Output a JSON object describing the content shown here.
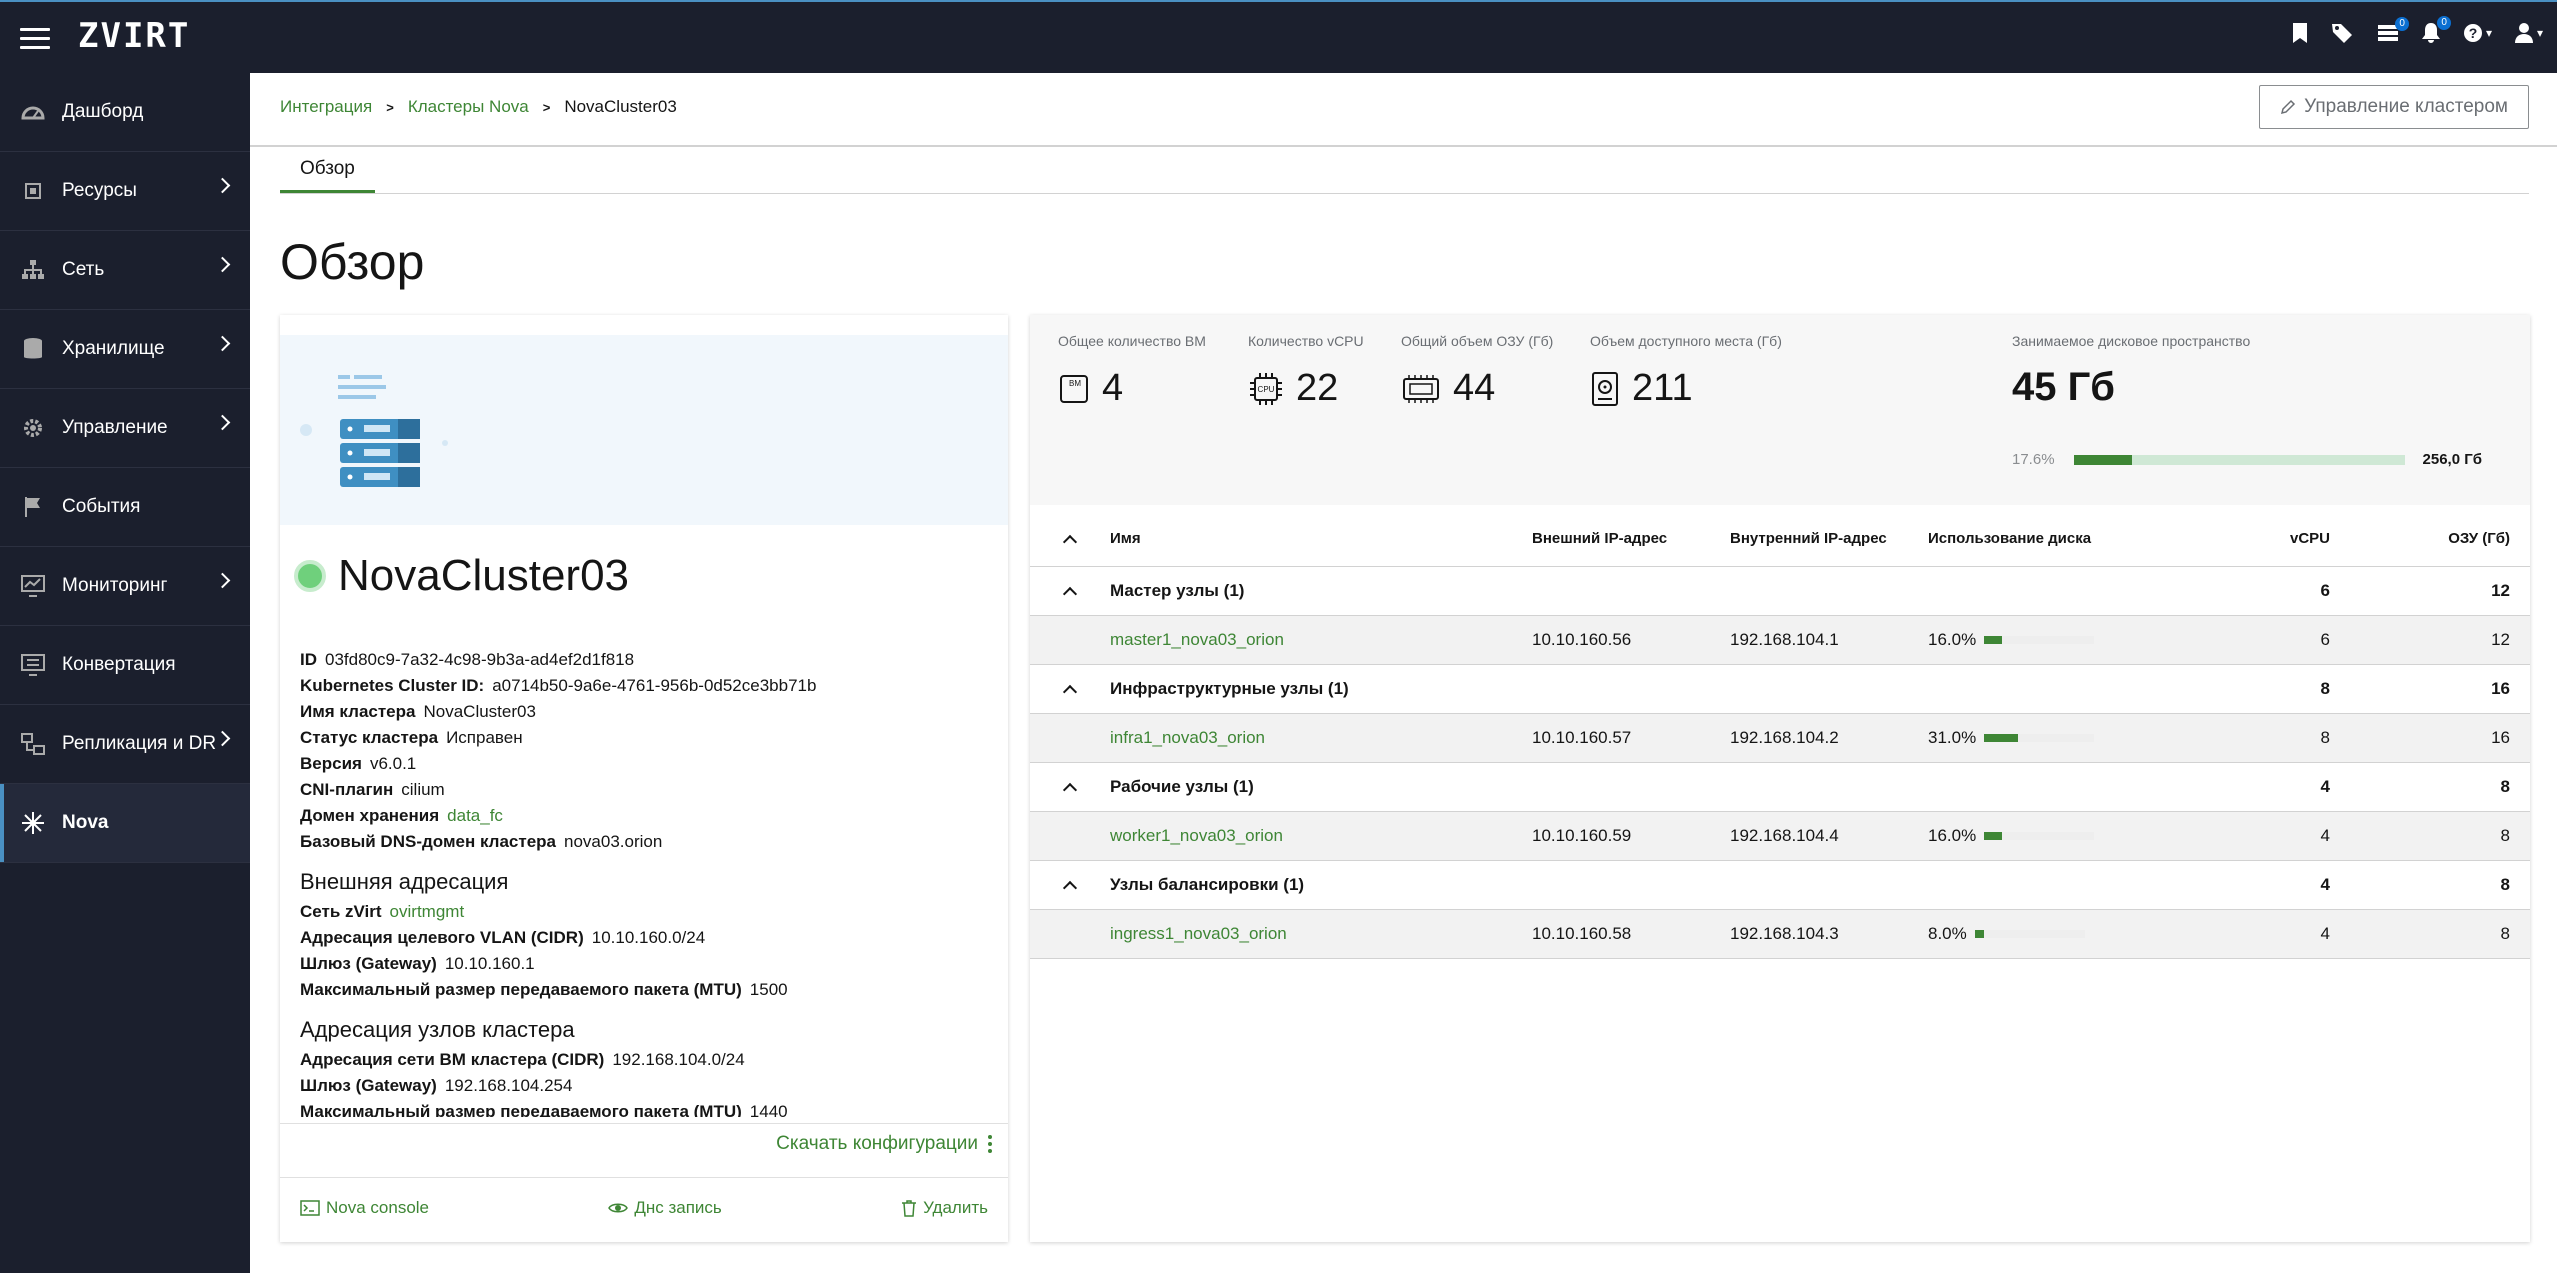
{
  "header": {
    "logo": "ZVIRT",
    "badge_tasks": "0",
    "badge_notifications": "0"
  },
  "sidebar": {
    "items": [
      {
        "label": "Дашборд"
      },
      {
        "label": "Ресурсы"
      },
      {
        "label": "Сеть"
      },
      {
        "label": "Хранилище"
      },
      {
        "label": "Управление"
      },
      {
        "label": "События"
      },
      {
        "label": "Мониторинг"
      },
      {
        "label": "Конвертация"
      },
      {
        "label": "Репликация и DR"
      },
      {
        "label": "Nova"
      }
    ]
  },
  "breadcrumb": {
    "items": [
      "Интеграция",
      "Кластеры Nova",
      "NovaCluster03"
    ]
  },
  "manage_button": "Управление кластером",
  "tabs": [
    "Обзор"
  ],
  "page_title": "Обзор",
  "cluster": {
    "name": "NovaCluster03",
    "status_color": "#6fd07c",
    "info": [
      {
        "key": "ID",
        "value": "03fd80c9-7a32-4c98-9b3a-ad4ef2d1f818"
      },
      {
        "key": "Kubernetes Cluster ID:",
        "value": "a0714b50-9a6e-4761-956b-0d52ce3bb71b"
      },
      {
        "key": "Имя кластера",
        "value": "NovaCluster03"
      },
      {
        "key": "Статус кластера",
        "value": "Исправен"
      },
      {
        "key": "Версия",
        "value": "v6.0.1"
      },
      {
        "key": "CNI-плагин",
        "value": "cilium"
      },
      {
        "key": "Домен хранения",
        "value": "data_fc"
      },
      {
        "key": "Базовый DNS-домен кластера",
        "value": "nova03.orion"
      }
    ],
    "external": {
      "title": "Внешняя адресация",
      "items": [
        {
          "key": "Сеть zVirt",
          "value": "ovirtmgmt"
        },
        {
          "key": "Адресация целевого VLAN (CIDR)",
          "value": "10.10.160.0/24"
        },
        {
          "key": "Шлюз (Gateway)",
          "value": "10.10.160.1"
        },
        {
          "key": "Максимальный размер передаваемого пакета (MTU)",
          "value": "1500"
        }
      ]
    },
    "nodes_addr": {
      "title": "Адресация узлов кластера",
      "items": [
        {
          "key": "Адресация сети ВМ кластера (CIDR)",
          "value": "192.168.104.0/24"
        },
        {
          "key": "Шлюз (Gateway)",
          "value": "192.168.104.254"
        },
        {
          "key": "Максимальный размер передаваемого пакета (MTU)",
          "value": "1440"
        }
      ]
    },
    "download_config": "Скачать конфигурации",
    "actions": {
      "console": "Nova console",
      "dns": "Днс запись",
      "delete": "Удалить"
    }
  },
  "stats": {
    "vm": {
      "label": "Общее количество ВМ",
      "value": "4"
    },
    "vcpu": {
      "label": "Количество vCPU",
      "value": "22"
    },
    "ram": {
      "label": "Общий объем ОЗУ (Гб)",
      "value": "44"
    },
    "space": {
      "label": "Объем доступного места (Гб)",
      "value": "211"
    },
    "disk": {
      "label": "Занимаемое дисковое пространство",
      "value": "45 Гб",
      "percent": "17.6%",
      "fraction": 0.176,
      "total": "256,0 Гб"
    }
  },
  "table": {
    "headers": {
      "name": "Имя",
      "ext_ip": "Внешний IP-адрес",
      "int_ip": "Внутренний IP-адрес",
      "disk": "Использование диска",
      "vcpu": "vCPU",
      "ram": "ОЗУ (Гб)"
    },
    "groups": [
      {
        "name": "Мастер узлы (1)",
        "vcpu": "6",
        "ram": "12",
        "node": {
          "name": "master1_nova03_orion",
          "ext_ip": "10.10.160.56",
          "int_ip": "192.168.104.1",
          "disk": "16.0%",
          "disk_fraction": 0.16,
          "vcpu": "6",
          "ram": "12"
        }
      },
      {
        "name": "Инфраструктурные узлы (1)",
        "vcpu": "8",
        "ram": "16",
        "node": {
          "name": "infra1_nova03_orion",
          "ext_ip": "10.10.160.57",
          "int_ip": "192.168.104.2",
          "disk": "31.0%",
          "disk_fraction": 0.31,
          "vcpu": "8",
          "ram": "16"
        }
      },
      {
        "name": "Рабочие узлы (1)",
        "vcpu": "4",
        "ram": "8",
        "node": {
          "name": "worker1_nova03_orion",
          "ext_ip": "10.10.160.59",
          "int_ip": "192.168.104.4",
          "disk": "16.0%",
          "disk_fraction": 0.16,
          "vcpu": "4",
          "ram": "8"
        }
      },
      {
        "name": "Узлы балансировки (1)",
        "vcpu": "4",
        "ram": "8",
        "node": {
          "name": "ingress1_nova03_orion",
          "ext_ip": "10.10.160.58",
          "int_ip": "192.168.104.3",
          "disk": "8.0%",
          "disk_fraction": 0.08,
          "vcpu": "4",
          "ram": "8"
        }
      }
    ]
  }
}
